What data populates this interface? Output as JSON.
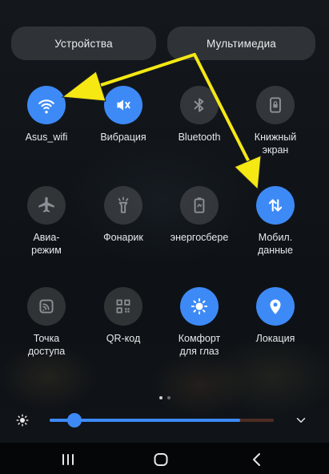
{
  "top_buttons": {
    "devices": "Устройства",
    "media": "Мультимедиа"
  },
  "tiles": [
    {
      "label": "Asus_wifi",
      "icon": "wifi-icon",
      "state": "on"
    },
    {
      "label": "Вибрация",
      "icon": "vibration-icon",
      "state": "on"
    },
    {
      "label": "Bluetooth",
      "icon": "bluetooth-icon",
      "state": "off"
    },
    {
      "label": "Книжный\nэкран",
      "icon": "portrait-lock-icon",
      "state": "off"
    },
    {
      "label": "Авиа-\nрежим",
      "icon": "airplane-icon",
      "state": "off"
    },
    {
      "label": "Фонарик",
      "icon": "flashlight-icon",
      "state": "off"
    },
    {
      "label": "энергосбере",
      "icon": "battery-saver-icon",
      "state": "off"
    },
    {
      "label": "Мобил.\nданные",
      "icon": "mobile-data-icon",
      "state": "on"
    },
    {
      "label": "Точка\nдоступа",
      "icon": "hotspot-icon",
      "state": "off"
    },
    {
      "label": "QR-код",
      "icon": "qr-code-icon",
      "state": "off"
    },
    {
      "label": "Комфорт\nдля глаз",
      "icon": "eye-comfort-icon",
      "state": "on"
    },
    {
      "label": "Локация",
      "icon": "location-icon",
      "state": "on"
    }
  ],
  "page_indicator": {
    "current": 1,
    "total": 2
  },
  "brightness": {
    "level": 0.11
  },
  "colors": {
    "accent": "#3d8af7",
    "annotation_arrow": "#f5e813"
  }
}
